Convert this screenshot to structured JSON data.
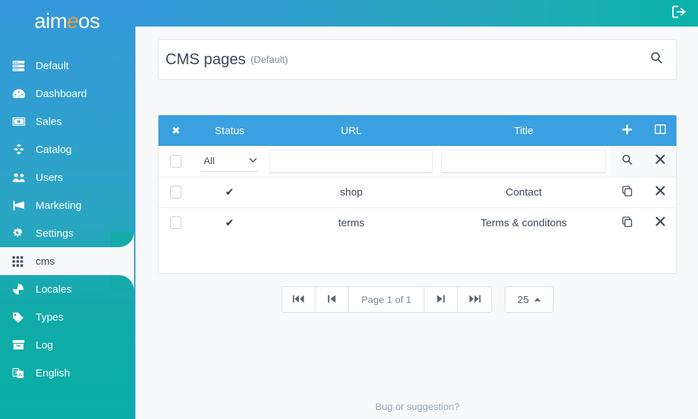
{
  "brand": {
    "logo_prefix": "aim",
    "logo_accent": "e",
    "logo_suffix": "os",
    "accent_color": "#e6a23c"
  },
  "topbar": {
    "logout_icon": "sign-out-icon"
  },
  "sidebar": {
    "items": [
      {
        "label": "Default",
        "icon": "server-icon",
        "active": false
      },
      {
        "label": "Dashboard",
        "icon": "gauge-icon",
        "active": false
      },
      {
        "label": "Sales",
        "icon": "money-bill-icon",
        "active": false
      },
      {
        "label": "Catalog",
        "icon": "cubes-icon",
        "active": false
      },
      {
        "label": "Users",
        "icon": "users-icon",
        "active": false
      },
      {
        "label": "Marketing",
        "icon": "bullhorn-icon",
        "active": false
      },
      {
        "label": "Settings",
        "icon": "cogs-icon",
        "active": false
      },
      {
        "label": "cms",
        "icon": "grid-icon",
        "active": true
      },
      {
        "label": "Locales",
        "icon": "globe-icon",
        "active": false
      },
      {
        "label": "Types",
        "icon": "tag-icon",
        "active": false
      },
      {
        "label": "Log",
        "icon": "archive-icon",
        "active": false
      },
      {
        "label": "English",
        "icon": "language-icon",
        "active": false
      }
    ]
  },
  "page": {
    "title": "CMS pages",
    "subtitle": "(Default)",
    "search_icon": "search-icon"
  },
  "table": {
    "headers": {
      "select": "✖",
      "status": "Status",
      "url": "URL",
      "title": "Title",
      "add_icon": "plus-icon",
      "columns_icon": "columns-icon"
    },
    "filter": {
      "status_value": "All",
      "status_options": [
        "All"
      ],
      "url_value": "",
      "url_placeholder": "",
      "title_value": "",
      "title_placeholder": "",
      "search_icon": "search-icon",
      "clear_icon": "close-icon"
    },
    "rows": [
      {
        "status": "✔",
        "url": "shop",
        "title": "Contact",
        "copy_icon": "copy-icon",
        "delete_icon": "close-icon"
      },
      {
        "status": "✔",
        "url": "terms",
        "title": "Terms & conditons",
        "copy_icon": "copy-icon",
        "delete_icon": "close-icon"
      }
    ]
  },
  "pagination": {
    "first_icon": "step-backward-fast-icon",
    "prev_icon": "step-backward-icon",
    "page_label": "Page 1 of 1",
    "next_icon": "step-forward-icon",
    "last_icon": "step-forward-fast-icon",
    "page_size": "25",
    "page_size_caret": "▲"
  },
  "footer": {
    "note": "Bug or suggestion?"
  },
  "colors": {
    "sidebar_top": "#3498db",
    "sidebar_bottom": "#0aada6",
    "table_header": "#3aa0e0",
    "table_header_actions": "#5cb0e8",
    "page_bg": "#f8f9fa"
  }
}
